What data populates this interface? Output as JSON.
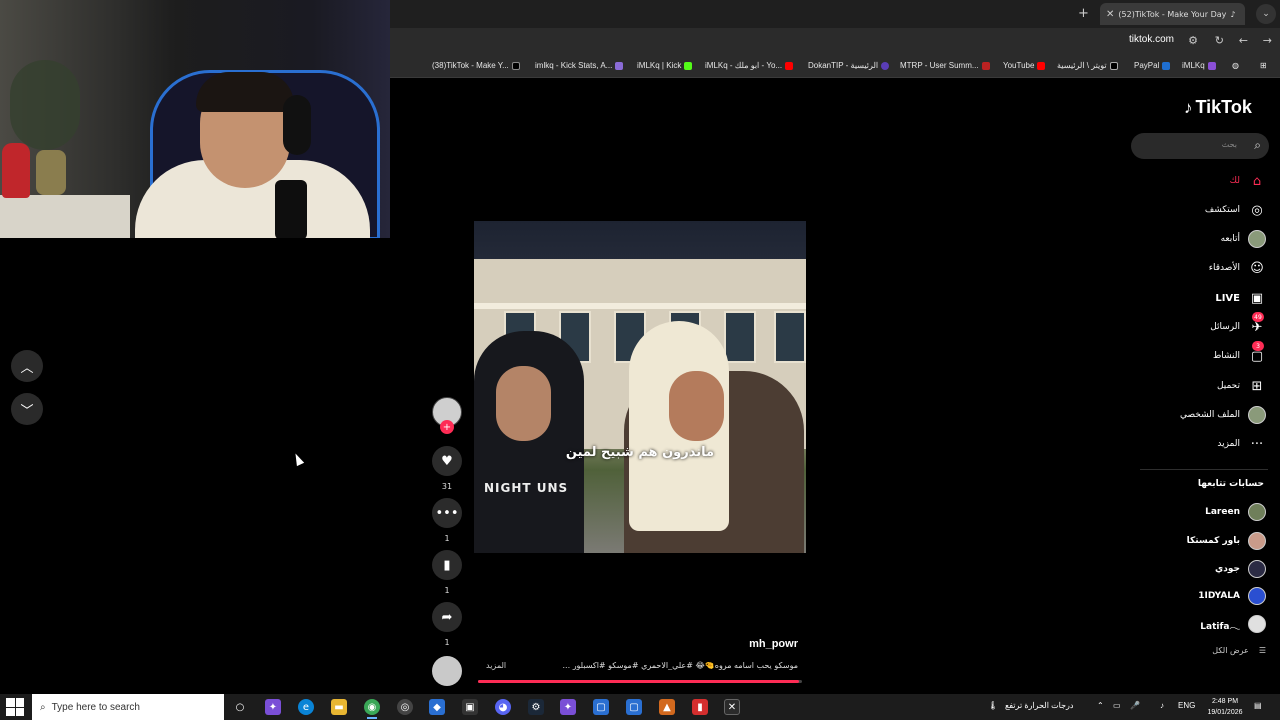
{
  "browser": {
    "active_tab_title": "(52)TikTok - Make Your Day",
    "url": "tiktok.com",
    "bookmarks": [
      "(38)TikTok - Make Y...",
      "imlkq - Kick Stats, A...",
      "iMLKq | Kick",
      "iMLKq - ابو ملك - Yo...",
      "DokanTIP - الرئيسية",
      "MTRP - User Summ...",
      "YouTube",
      "تويتر \\ الرئيسية",
      "PayPal",
      "iMLKq"
    ]
  },
  "feed": {
    "video_caption_overlay": "ماندرون هم شبيح لمين",
    "shirt_text": "NIGHT UNS",
    "author": "mh_powr",
    "description": "موسكو يحب اسامه مروه🤏😂 #علي_الاحمري #موسكو #اكسبلور ...",
    "more_label": "المزيد",
    "progress": 0.99,
    "actions": {
      "likes": "31",
      "comments": "1",
      "saves": "1",
      "shares": "1"
    }
  },
  "sidebar": {
    "logo": "TikTok",
    "search_placeholder": "بحث",
    "nav": [
      {
        "label": "لك",
        "icon": "home-icon",
        "active": true
      },
      {
        "label": "استكشف",
        "icon": "compass-icon"
      },
      {
        "label": "أتابعه",
        "icon": "avatar"
      },
      {
        "label": "الأصدقاء",
        "icon": "friends-icon"
      },
      {
        "label": "LIVE",
        "icon": "live-icon"
      },
      {
        "label": "الرسائل",
        "icon": "messages-icon",
        "badge": "49"
      },
      {
        "label": "النشاط",
        "icon": "activity-icon",
        "badge": "3"
      },
      {
        "label": "تحميل",
        "icon": "upload-icon"
      },
      {
        "label": "الملف الشخصي",
        "icon": "avatar"
      },
      {
        "label": "المزيد",
        "icon": "more-icon"
      }
    ],
    "following_heading": "حسابات تتابعها",
    "following": [
      "Lareen",
      "باور كمستكا",
      "جودي",
      "1IDYALA",
      "Latifa𓂃"
    ],
    "see_all": "عرض الكل"
  },
  "taskbar": {
    "search_placeholder": "Type here to search",
    "weather": "درجات الحرارة ترتفع",
    "language": "ENG",
    "time": "2:48 PM",
    "date": "19/01/2026"
  },
  "colors": {
    "accent": "#fe2c55",
    "background": "#000000"
  }
}
